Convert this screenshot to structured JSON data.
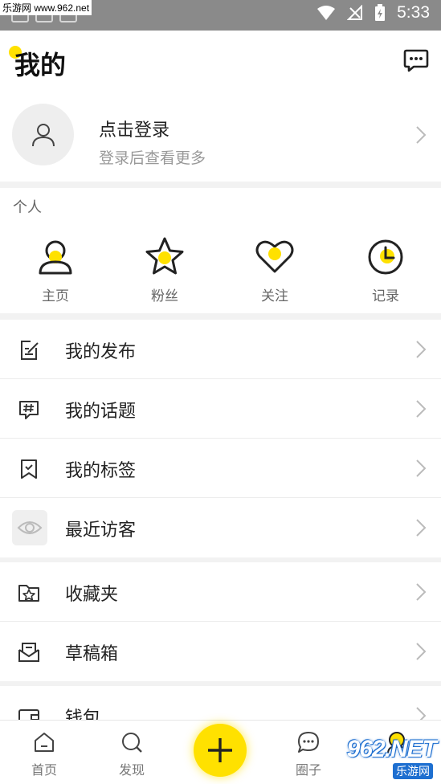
{
  "statusbar": {
    "time": "5:33",
    "watermark": "乐游网 www.962.net"
  },
  "header": {
    "title": "我的"
  },
  "profile": {
    "login_title": "点击登录",
    "login_subtitle": "登录后查看更多"
  },
  "personal": {
    "label": "个人",
    "items": [
      {
        "label": "主页",
        "icon": "user-icon"
      },
      {
        "label": "粉丝",
        "icon": "star-icon"
      },
      {
        "label": "关注",
        "icon": "heart-icon"
      },
      {
        "label": "记录",
        "icon": "clock-icon"
      }
    ]
  },
  "menu1": [
    {
      "label": "我的发布",
      "icon": "edit-icon"
    },
    {
      "label": "我的话题",
      "icon": "hashtag-icon"
    },
    {
      "label": "我的标签",
      "icon": "bookmark-icon"
    },
    {
      "label": "最近访客",
      "icon": "eye-icon"
    }
  ],
  "menu2": [
    {
      "label": "收藏夹",
      "icon": "folder-star-icon"
    },
    {
      "label": "草稿箱",
      "icon": "draft-icon"
    }
  ],
  "menu3": [
    {
      "label": "钱包",
      "icon": "wallet-icon"
    }
  ],
  "tabs": [
    {
      "label": "首页",
      "icon": "home-icon"
    },
    {
      "label": "发现",
      "icon": "discover-icon"
    },
    {
      "label": "",
      "icon": "plus-icon"
    },
    {
      "label": "圈子",
      "icon": "chat-icon"
    },
    {
      "label": "",
      "icon": "profile-icon"
    }
  ],
  "watermark": {
    "number": "962.NET",
    "text": "乐游网"
  },
  "colors": {
    "accent": "#ffe100",
    "text": "#222222",
    "muted": "#999999"
  }
}
